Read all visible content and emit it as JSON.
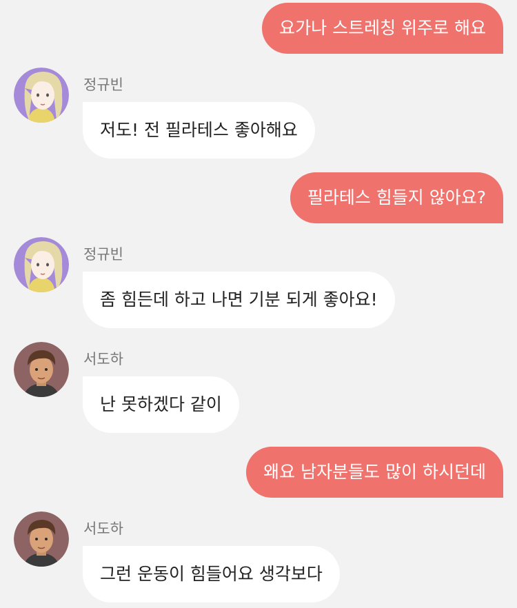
{
  "messages": [
    {
      "side": "out",
      "text": "요가나 스트레칭 위주로 해요"
    },
    {
      "side": "in",
      "sender": "정규빈",
      "avatar": "female-blonde-avatar",
      "text": "저도! 전 필라테스 좋아해요"
    },
    {
      "side": "out",
      "text": "필라테스 힘들지 않아요?"
    },
    {
      "side": "in",
      "sender": "정규빈",
      "avatar": "female-blonde-avatar",
      "text": "좀 힘든데 하고 나면 기분 되게 좋아요!"
    },
    {
      "side": "in",
      "sender": "서도하",
      "avatar": "male-brunette-avatar",
      "text": "난 못하겠다 같이"
    },
    {
      "side": "out",
      "text": "왜요 남자분들도 많이 하시던데"
    },
    {
      "side": "in",
      "sender": "서도하",
      "avatar": "male-brunette-avatar",
      "text": "그런 운동이 힘들어요 생각보다"
    }
  ],
  "colors": {
    "background": "#f2f2f2",
    "outgoing_bubble": "#ef726c",
    "incoming_bubble": "#ffffff"
  }
}
